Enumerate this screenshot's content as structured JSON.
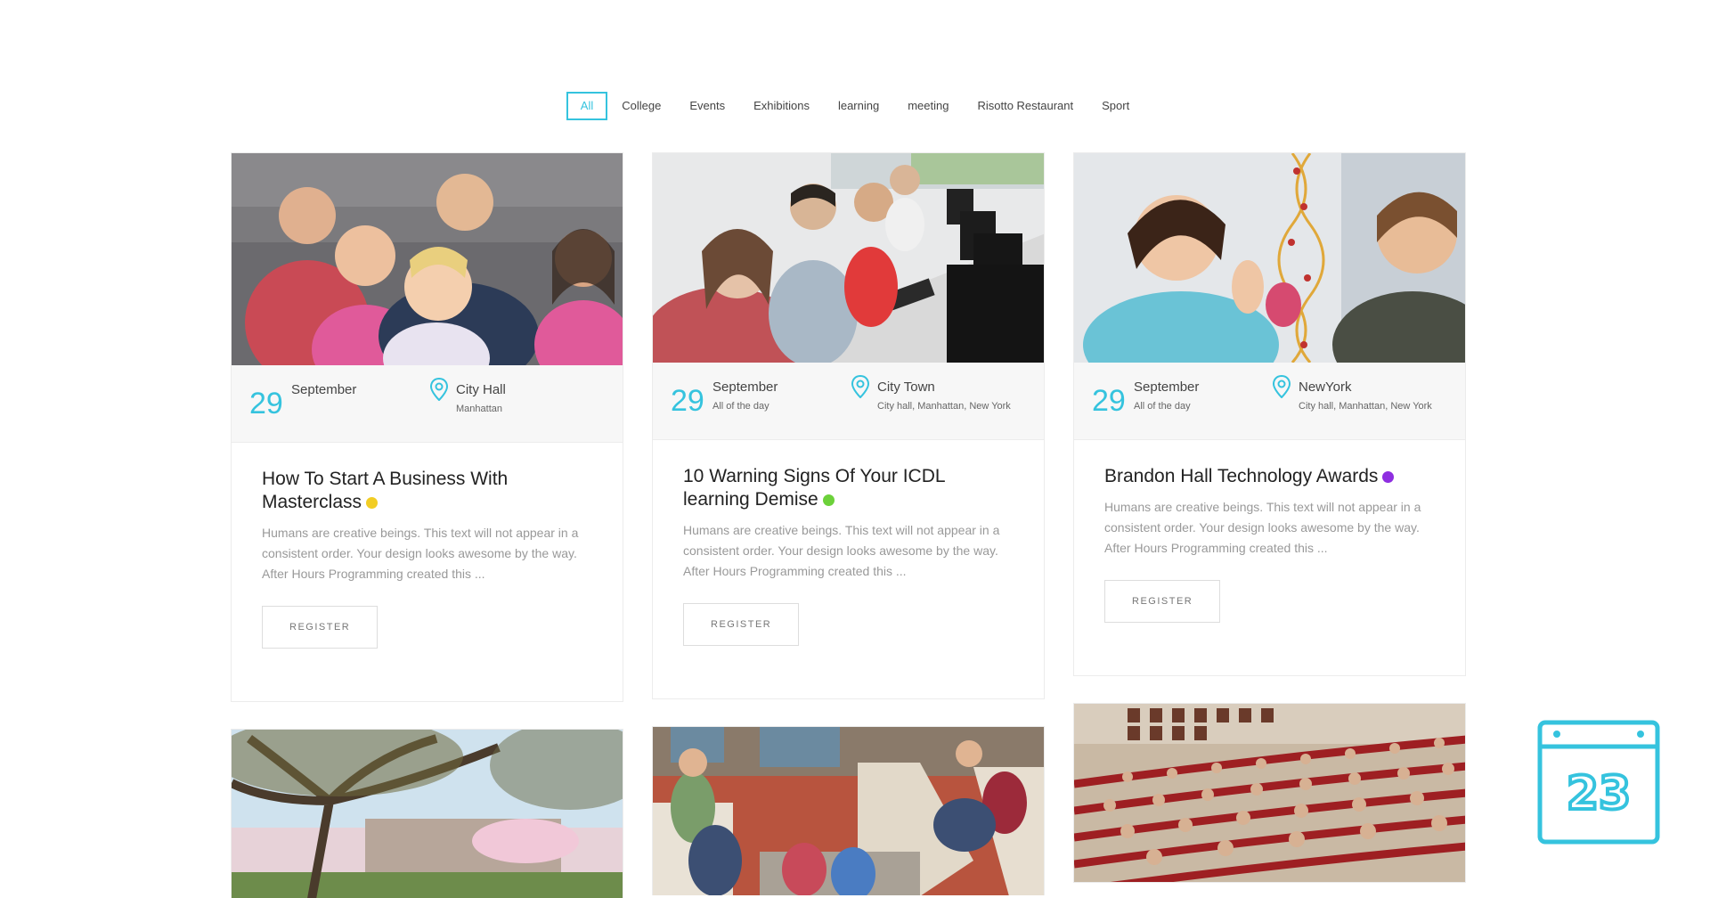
{
  "filters": [
    "All",
    "College",
    "Events",
    "Exhibitions",
    "learning",
    "meeting",
    "Risotto Restaurant",
    "Sport"
  ],
  "active_filter": "All",
  "events": [
    {
      "day": "29",
      "month": "September",
      "daytime": "",
      "place": "City Hall",
      "address": "Manhattan",
      "title": "How To Start A Business With Masterclass",
      "dot_color": "#f2cd24",
      "excerpt": "Humans are creative beings. This text will not appear in a consistent order. Your design looks awesome by the way. After Hours Programming created this ...",
      "button": "REGISTER"
    },
    {
      "day": "29",
      "month": "September",
      "daytime": "All of the day",
      "place": "City Town",
      "address": "City hall, Manhattan, New York",
      "title": "10 Warning Signs Of Your ICDL learning Demise",
      "dot_color": "#6cd13a",
      "excerpt": "Humans are creative beings. This text will not appear in a consistent order. Your design looks awesome by the way. After Hours Programming created this ...",
      "button": "REGISTER"
    },
    {
      "day": "29",
      "month": "September",
      "daytime": "All of the day",
      "place": "NewYork",
      "address": "City hall, Manhattan, New York",
      "title": "Brandon Hall Technology Awards",
      "dot_color": "#8e2ee0",
      "excerpt": "Humans are creative beings. This text will not appear in a consistent order. Your design looks awesome by the way. After Hours Programming created this ...",
      "button": "REGISTER"
    }
  ],
  "calendar_widget": {
    "number": "23"
  },
  "colors": {
    "accent": "#35c3de"
  }
}
